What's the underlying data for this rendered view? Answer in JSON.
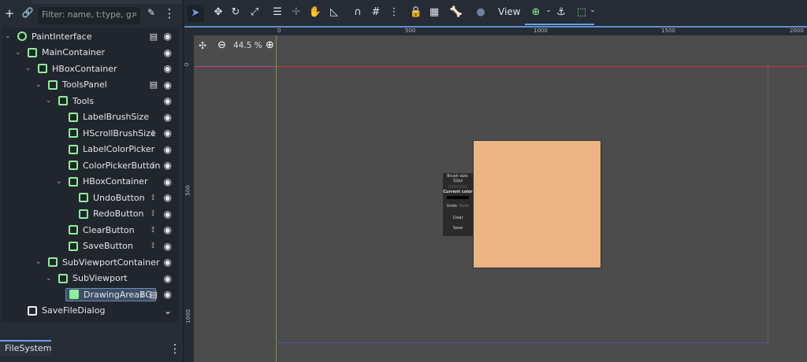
{
  "scene_dock": {
    "filter_placeholder": "Filter: name, t:type, g:",
    "items": [
      {
        "label": "PaintInterface",
        "depth": 0,
        "script": true,
        "signal": false
      },
      {
        "label": "MainContainer",
        "depth": 1,
        "script": false,
        "signal": false
      },
      {
        "label": "HBoxContainer",
        "depth": 2,
        "script": false,
        "signal": false
      },
      {
        "label": "ToolsPanel",
        "depth": 3,
        "script": true,
        "signal": false
      },
      {
        "label": "Tools",
        "depth": 4,
        "script": false,
        "signal": false
      },
      {
        "label": "LabelBrushSize",
        "depth": 5,
        "script": false,
        "signal": false
      },
      {
        "label": "HScrollBrushSize",
        "depth": 5,
        "script": false,
        "signal": true
      },
      {
        "label": "LabelColorPicker",
        "depth": 5,
        "script": false,
        "signal": false
      },
      {
        "label": "ColorPickerButton",
        "depth": 5,
        "script": false,
        "signal": true
      },
      {
        "label": "HBoxContainer",
        "depth": 5,
        "script": false,
        "signal": false
      },
      {
        "label": "UndoButton",
        "depth": 6,
        "script": false,
        "signal": true
      },
      {
        "label": "RedoButton",
        "depth": 6,
        "script": false,
        "signal": true
      },
      {
        "label": "ClearButton",
        "depth": 5,
        "script": false,
        "signal": true
      },
      {
        "label": "SaveButton",
        "depth": 5,
        "script": false,
        "signal": true
      },
      {
        "label": "SubViewportContainer",
        "depth": 3,
        "script": false,
        "signal": false
      },
      {
        "label": "SubViewport",
        "depth": 4,
        "script": false,
        "signal": false
      },
      {
        "label": "DrawingAreaBG",
        "depth": 5,
        "script": true,
        "signal": true,
        "selected": true
      },
      {
        "label": "SaveFileDialog",
        "depth": 1,
        "script": false,
        "signal": false
      }
    ]
  },
  "filesystem": {
    "tab": "FileSystem"
  },
  "toolbar": {
    "view": "View"
  },
  "viewport": {
    "zoom": "44.5 %",
    "ruler_h": [
      "0",
      "500",
      "1000",
      "1500",
      "2000"
    ],
    "ruler_v": [
      "0",
      "500",
      "1000"
    ],
    "canvas_color": "#ecb384"
  },
  "preview": {
    "brush": "Brush size: 32px",
    "color": "Current color",
    "undo": "Undo",
    "redo": "Redo",
    "clear": "Clear",
    "save": "Save"
  }
}
